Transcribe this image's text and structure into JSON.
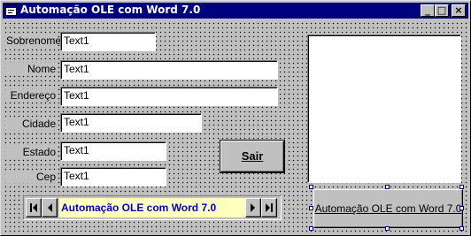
{
  "window": {
    "title": "Automação OLE com Word 7.0",
    "controls": {
      "minimize": "_",
      "maximize": "□",
      "close": "×"
    }
  },
  "fields": [
    {
      "label": "Sobrenome",
      "value": "Text1"
    },
    {
      "label": "Nome",
      "value": "Text1"
    },
    {
      "label": "Endereço",
      "value": "Text1"
    },
    {
      "label": "Cidade",
      "value": "Text1"
    },
    {
      "label": "Estado",
      "value": "Text1"
    },
    {
      "label": "Cep",
      "value": "Text1"
    }
  ],
  "buttons": {
    "exit_label": "Sair",
    "automation_label": "Automação OLE com Word 7.0"
  },
  "data_control": {
    "caption": "Automação OLE com Word 7.0"
  },
  "colors": {
    "titlebar": "#000080",
    "face": "#c0c0c0",
    "data_caption_bg": "#ffffc0",
    "data_caption_text": "#0000c0"
  }
}
